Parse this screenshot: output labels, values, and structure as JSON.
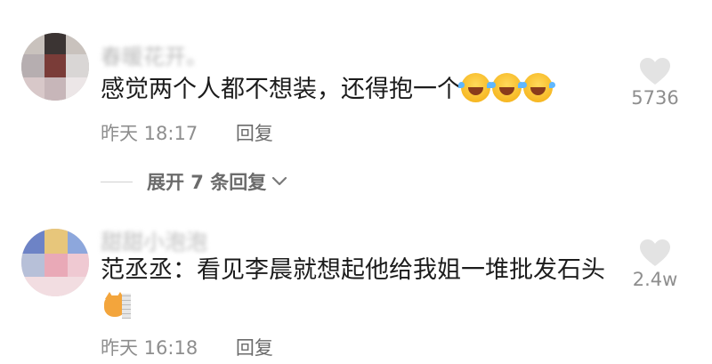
{
  "comments": [
    {
      "username": "春暖花开。",
      "content": "感觉两个人都不想装，还得抱一个",
      "emojis": [
        "laugh-cry-emoji",
        "laugh-cry-emoji",
        "laugh-cry-emoji"
      ],
      "time": "昨天 18:17",
      "reply_label": "回复",
      "likes": "5736",
      "expand_label": "展开 7 条回复"
    },
    {
      "username": "甜甜小泡泡",
      "content": "范丞丞：看见李晨就想起他给我姐一堆批发石头",
      "sticker": "cat-sticker",
      "time": "昨天 16:18",
      "reply_label": "回复",
      "likes": "2.4w"
    }
  ],
  "icons": {
    "like": "heart-icon",
    "expand": "chevron-down-icon"
  },
  "colors": {
    "text": "#1c1c1c",
    "meta": "#8e8e8e",
    "heart": "#e3e3e3"
  }
}
